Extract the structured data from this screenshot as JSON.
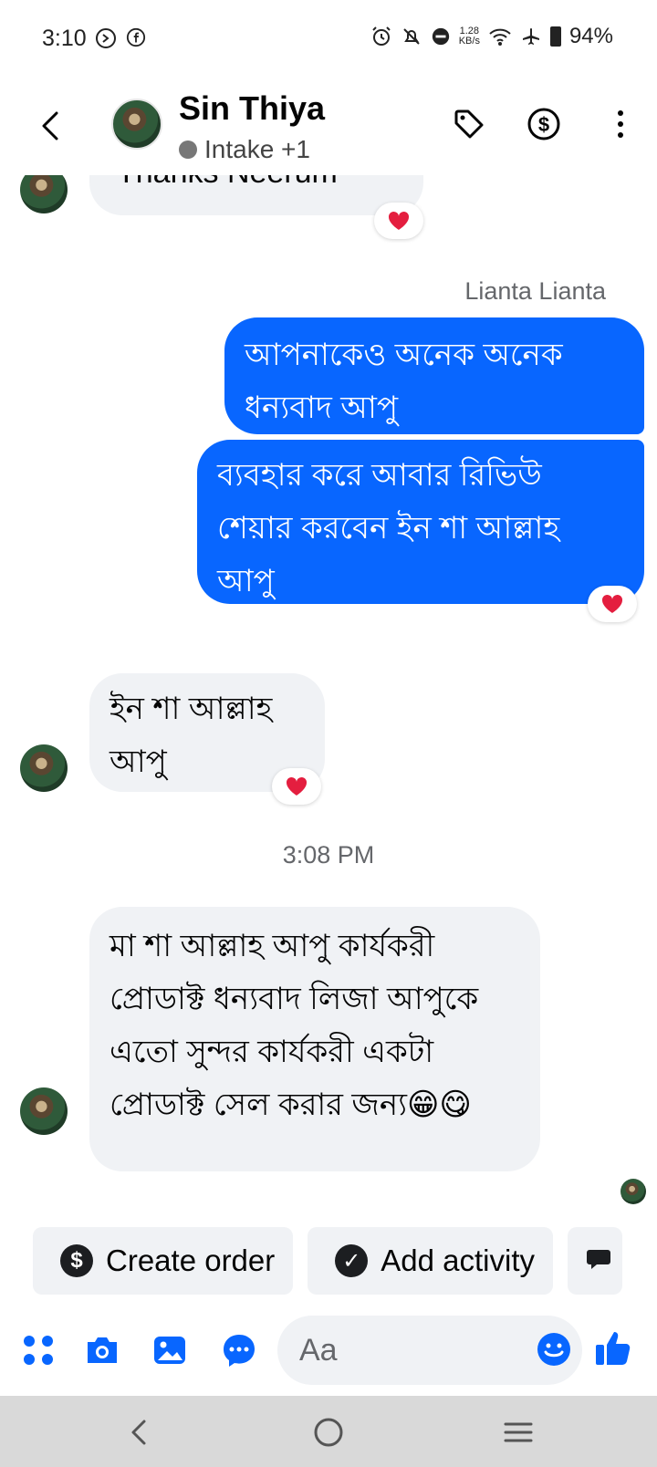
{
  "status_bar": {
    "time": "3:10",
    "speed_value": "1.28",
    "speed_unit": "KB/s",
    "battery": "94%"
  },
  "header": {
    "contact_name": "Sin Thiya",
    "contact_subtitle": "Intake +1",
    "icons": [
      "back-icon",
      "tag-icon",
      "dollar-icon",
      "more-icon"
    ]
  },
  "messages": {
    "partial_top_text": "Thanks Neerum",
    "sender_label": "Lianta Lianta",
    "out_1": "আপনাকেও অনেক অনেক ধন্যবাদ আপু",
    "out_2": "ব্যবহার করে আবার রিভিউ শেয়ার করবেন ইন শা আল্লাহ আপু",
    "in_1": "ইন শা আল্লাহ আপু",
    "timestamp": "3:08 PM",
    "in_2": "মা শা আল্লাহ আপু কার্যকরী প্রোডাক্ট ধন্যবাদ লিজা আপুকে এতো সুন্দর কার্যকরী একটা প্রোডাক্ট সেল করার জন্য😁😋"
  },
  "quick_actions": {
    "create_order": "Create order",
    "add_activity": "Add activity"
  },
  "composer": {
    "placeholder": "Aa"
  },
  "colors": {
    "outgoing_bubble": "#0866ff",
    "incoming_bubble": "#f0f2f5",
    "accent": "#0866ff",
    "heart": "#e41e3f"
  }
}
